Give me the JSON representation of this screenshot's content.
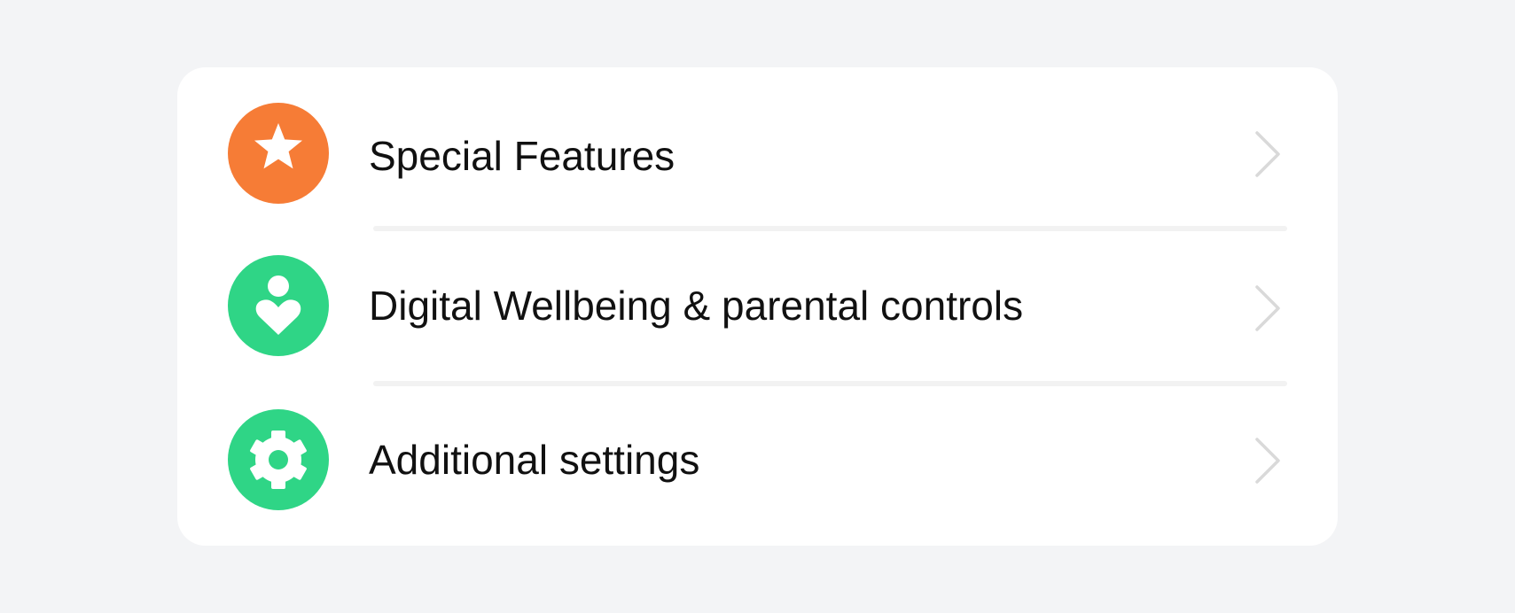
{
  "settings_list": {
    "items": [
      {
        "label": "Special Features",
        "icon": "star-icon",
        "icon_bg": "#f67c36"
      },
      {
        "label": "Digital Wellbeing & parental controls",
        "icon": "wellbeing-icon",
        "icon_bg": "#2fd586"
      },
      {
        "label": "Additional settings",
        "icon": "gear-icon",
        "icon_bg": "#2fd586"
      }
    ]
  },
  "colors": {
    "background": "#f3f4f6",
    "card": "#ffffff",
    "text": "#111111",
    "chevron": "#d9d9d9",
    "divider": "#f2f2f2"
  }
}
